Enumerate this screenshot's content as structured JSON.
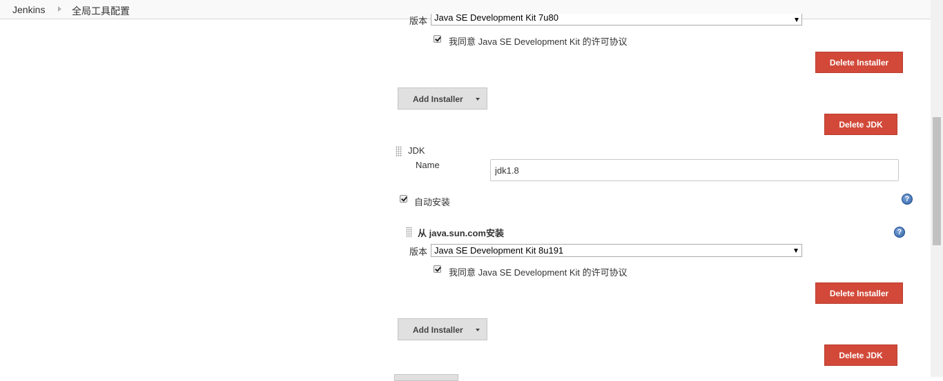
{
  "breadcrumb": {
    "home": "Jenkins",
    "current": "全局工具配置"
  },
  "installer_top": {
    "version_label": "版本",
    "version_value": "Java SE Development Kit 7u80",
    "agree_label": "我同意 Java SE Development Kit 的许可协议",
    "agree_checked": true,
    "delete_installer": "Delete Installer"
  },
  "add_installer": "Add Installer",
  "delete_jdk": "Delete JDK",
  "jdk": {
    "section_label": "JDK",
    "name_label": "Name",
    "name_value": "jdk1.8",
    "auto_install_label": "自动安装",
    "auto_install_checked": true,
    "installer": {
      "title": "从 java.sun.com安装",
      "version_label": "版本",
      "version_value": "Java SE Development Kit 8u191",
      "agree_label": "我同意 Java SE Development Kit 的许可协议",
      "agree_checked": true,
      "delete_installer": "Delete Installer"
    }
  },
  "help_icon_glyph": "?",
  "colors": {
    "delete_button": "#d24939",
    "secondary_button": "#e0e0e0",
    "help_icon": "#2f62a8"
  }
}
